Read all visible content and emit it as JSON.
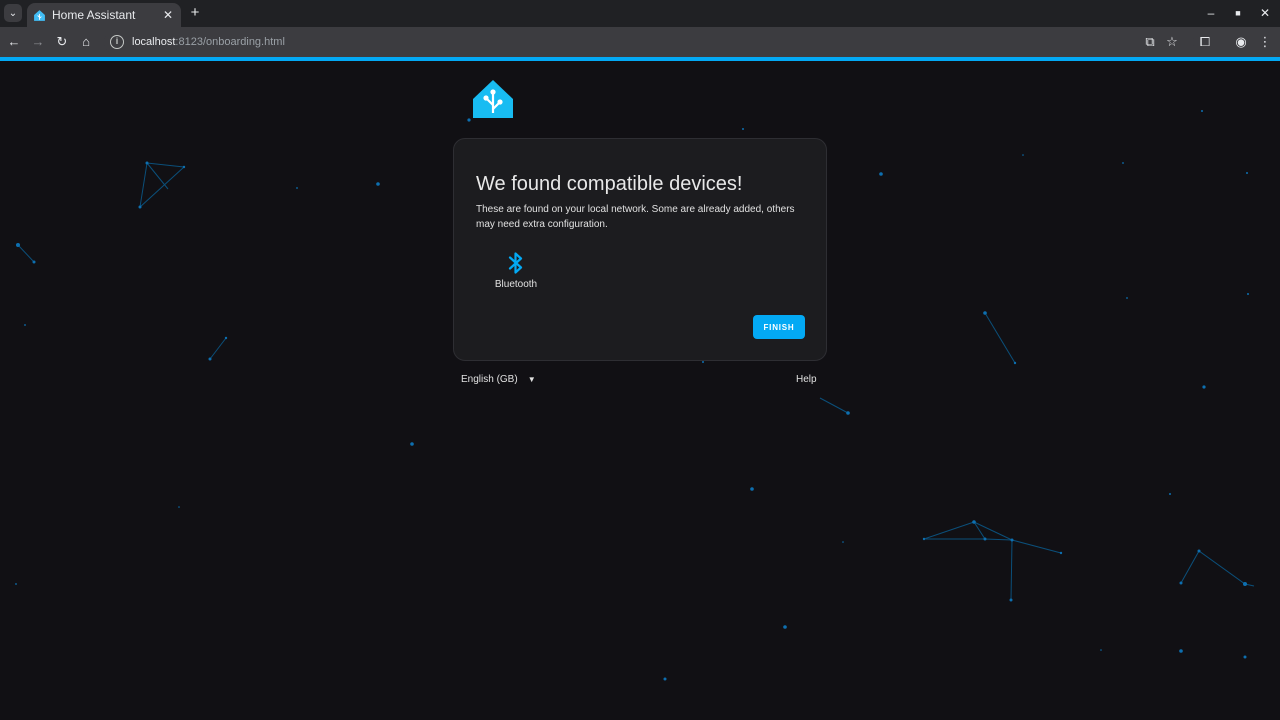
{
  "browser": {
    "tab_title": "Home Assistant",
    "url_host": "localhost",
    "url_path": ":8123/onboarding.html"
  },
  "card": {
    "title": "We found compatible devices!",
    "description": "These are found on your local network. Some are already added, others may need extra configuration.",
    "devices": [
      {
        "name": "Bluetooth",
        "icon": "bluetooth-icon"
      }
    ],
    "finish_label": "FINISH"
  },
  "footer": {
    "language": "English (GB)",
    "help_label": "Help"
  },
  "colors": {
    "accent": "#03a9f4",
    "background": "#111014",
    "card": "#1c1c1f"
  }
}
